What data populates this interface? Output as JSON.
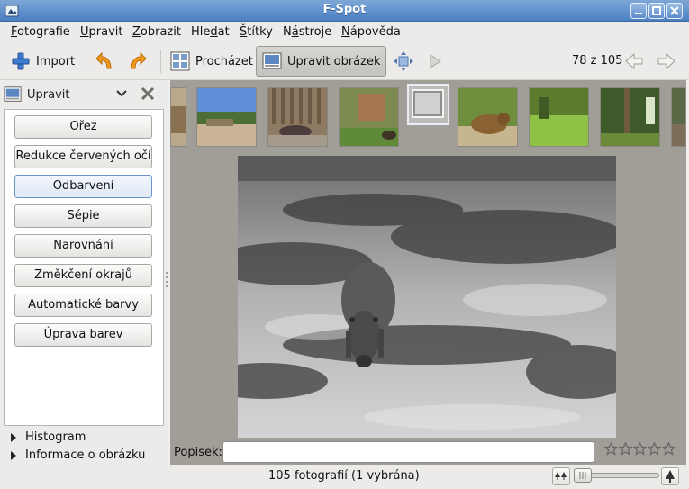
{
  "window": {
    "title": "F-Spot"
  },
  "menu": [
    {
      "pre": "",
      "u": "F",
      "post": "otografie"
    },
    {
      "pre": "",
      "u": "U",
      "post": "pravit"
    },
    {
      "pre": "",
      "u": "Z",
      "post": "obrazit"
    },
    {
      "pre": "Hle",
      "u": "d",
      "post": "at"
    },
    {
      "pre": "",
      "u": "Š",
      "post": "títky"
    },
    {
      "pre": "N",
      "u": "á",
      "post": "stroje"
    },
    {
      "pre": "",
      "u": "N",
      "post": "ápověda"
    }
  ],
  "toolbar": {
    "import_label": "Import",
    "browse_label": "Procházet",
    "edit_label": "Upravit obrázek",
    "counter": "78 z 105"
  },
  "editor": {
    "selected": "Upravit",
    "tools": [
      "Ořez",
      "Redukce červených očí",
      "Odbarvení",
      "Sépie",
      "Narovnání",
      "Změkčení okrajů",
      "Automatické barvy",
      "Úprava barev"
    ],
    "focused_index": 2
  },
  "expanders": {
    "histogram": "Histogram",
    "info": "Informace o obrázku"
  },
  "caption": {
    "label": "Popisek:",
    "value": ""
  },
  "rating": {
    "stars": 0,
    "max": 5
  },
  "status": {
    "text": "105 fotografií (1 vybrána)",
    "zoom_fraction": 0.0
  },
  "colors": {
    "titlebar": "#4a7fc1",
    "accent": "#6e95c9",
    "photo_bg": "#a19e98"
  }
}
